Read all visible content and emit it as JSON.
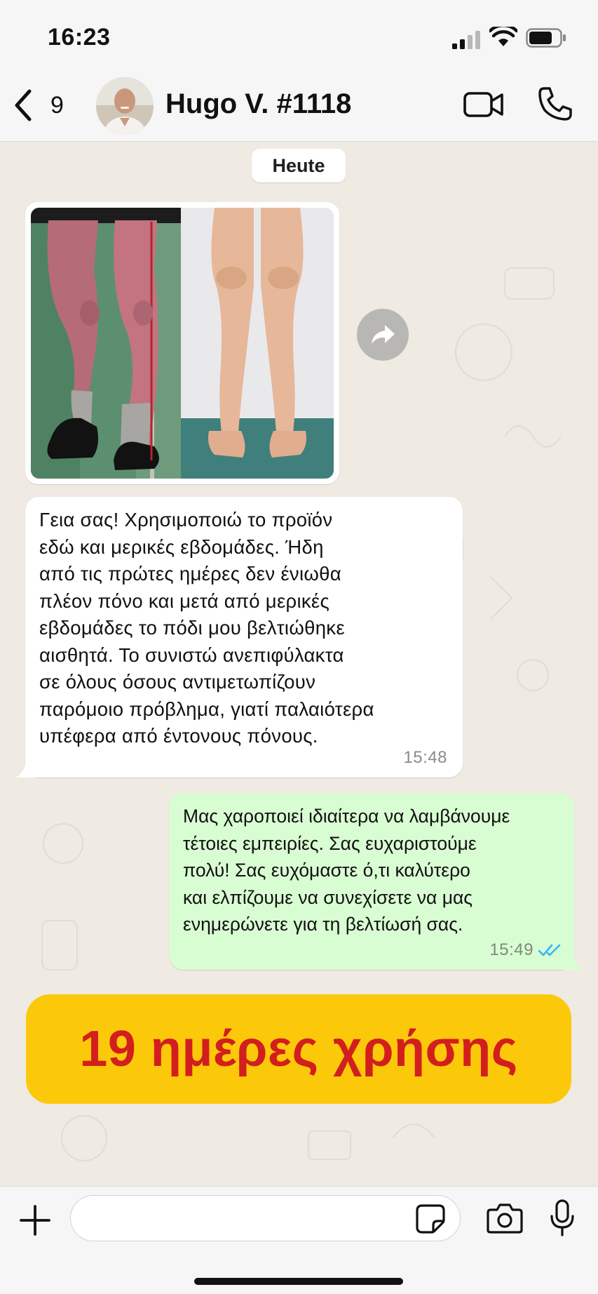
{
  "status_bar": {
    "time": "16:23"
  },
  "header": {
    "back_count": "9",
    "contact_name": "Hugo V. #1118"
  },
  "chat": {
    "date_label": "Heute",
    "messages": [
      {
        "direction": "in",
        "type": "image",
        "content": "before-after-legs-photo"
      },
      {
        "direction": "in",
        "type": "text",
        "text": "Γεια σας! Χρησιμοποιώ το προϊόν\nεδώ και μερικές εβδομάδες. Ήδη\nαπό τις πρώτες ημέρες δεν ένιωθα\nπλέον πόνο και μετά από μερικές\nεβδομάδες το πόδι μου βελτιώθηκε\nαισθητά. Το συνιστώ ανεπιφύλακτα\nσε όλους όσους αντιμετωπίζουν\nπαρόμοιο πρόβλημα, γιατί παλαιότερα\nυπέφερα από έντονους πόνους.",
        "time": "15:48"
      },
      {
        "direction": "out",
        "type": "text",
        "text": "Μας χαροποιεί ιδιαίτερα να λαμβάνουμε\nτέτοιες εμπειρίες. Σας ευχαριστούμε\nπολύ! Σας ευχόμαστε ό,τι καλύτερο\nκαι ελπίζουμε να συνεχίσετε να μας\nενημερώνετε για τη βελτίωσή σας.",
        "time": "15:49",
        "status": "read"
      }
    ]
  },
  "banner": {
    "text": "19 ημέρες χρήσης",
    "background": "#fcc90a",
    "color": "#d31e1e"
  },
  "input": {
    "placeholder": "",
    "value": ""
  },
  "colors": {
    "chat_background": "#efeae2",
    "outgoing_bubble": "#d9fdd3",
    "incoming_bubble": "#ffffff",
    "read_ticks": "#34b7f1"
  },
  "icons": [
    "back-chevron-icon",
    "video-camera-icon",
    "phone-icon",
    "forward-icon",
    "double-check-icon",
    "plus-icon",
    "sticker-icon",
    "camera-icon",
    "microphone-icon",
    "signal-icon",
    "wifi-icon",
    "battery-icon"
  ]
}
